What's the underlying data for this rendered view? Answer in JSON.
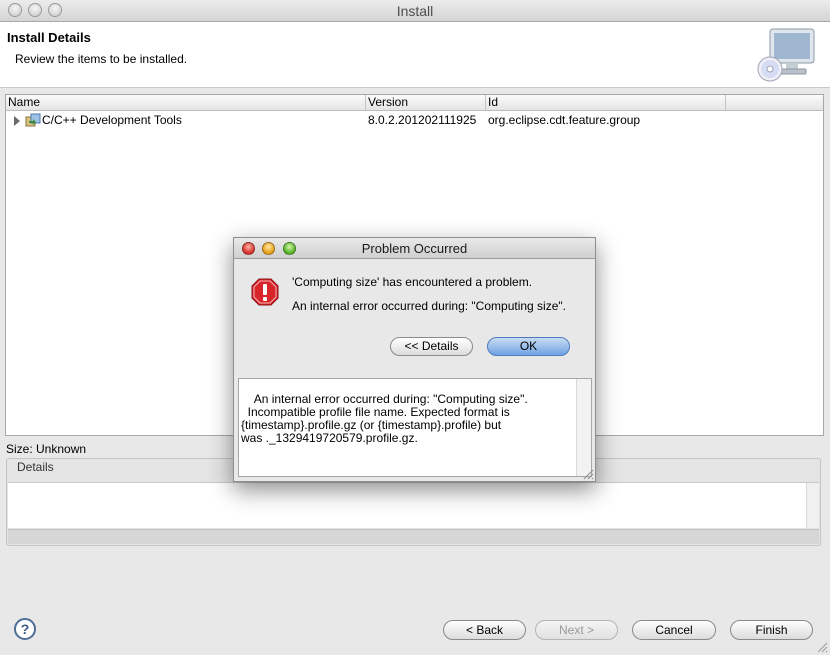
{
  "window": {
    "title": "Install"
  },
  "header": {
    "title": "Install Details",
    "subtitle": "Review the items to be installed.",
    "icon": "computer-cd-icon"
  },
  "table": {
    "columns": [
      "Name",
      "Version",
      "Id"
    ],
    "rows": [
      {
        "name": "C/C++ Development Tools",
        "version": "8.0.2.201202111925",
        "id": "org.eclipse.cdt.feature.group"
      }
    ]
  },
  "size_label": "Size: Unknown",
  "details": {
    "legend": "Details"
  },
  "dialog": {
    "title": "Problem Occurred",
    "message": "'Computing size' has encountered a problem.",
    "detail": "An internal error occurred during: \"Computing size\".",
    "details_button": "<< Details",
    "ok_button": "OK",
    "error_text": "An internal error occurred during: \"Computing size\".\n  Incompatible profile file name. Expected format is\n{timestamp}.profile.gz (or {timestamp}.profile) but\nwas ._1329419720579.profile.gz."
  },
  "buttons": {
    "back": "< Back",
    "next": "Next >",
    "cancel": "Cancel",
    "finish": "Finish"
  },
  "help": {
    "label": "?"
  },
  "colors": {
    "accent": "#6ea2e2",
    "error_red": "#d8252a"
  }
}
